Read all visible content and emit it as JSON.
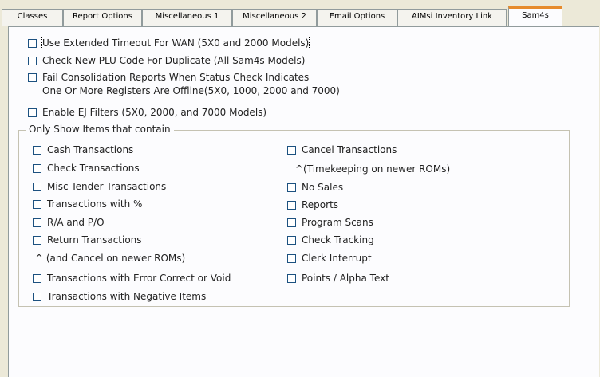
{
  "tabs": [
    {
      "label": "Classes"
    },
    {
      "label": "Report Options"
    },
    {
      "label": "Miscellaneous 1"
    },
    {
      "label": "Miscellaneous 2"
    },
    {
      "label": "Email Options"
    },
    {
      "label": "AIMsi Inventory Link"
    },
    {
      "label": "Sam4s"
    }
  ],
  "options": {
    "extended_timeout": "Use Extended Timeout For WAN (5X0 and 2000 Models)",
    "check_plu": "Check New PLU Code For Duplicate (All Sam4s Models)",
    "fail_consolidation_line1": "Fail Consolidation Reports When Status Check Indicates",
    "fail_consolidation_line2": "One Or More Registers Are Offline(5X0, 1000, 2000 and 7000)",
    "enable_ej": "Enable EJ Filters (5X0, 2000, and 7000 Models)"
  },
  "filters": {
    "group_title": "Only Show Items that contain",
    "left": [
      "Cash Transactions",
      "Check Transactions",
      "Misc Tender Transactions",
      "Transactions with %",
      "R/A and P/O",
      "Return Transactions"
    ],
    "left_note": "^ (and Cancel on newer ROMs)",
    "left_bottom": [
      "Transactions with Error Correct or Void",
      "Transactions with Negative Items"
    ],
    "right_top": "Cancel Transactions",
    "right_note": "^(Timekeeping on newer ROMs)",
    "right": [
      "No Sales",
      "Reports",
      "Program Scans",
      "Check Tracking",
      "Clerk Interrupt",
      "Points / Alpha Text"
    ]
  }
}
